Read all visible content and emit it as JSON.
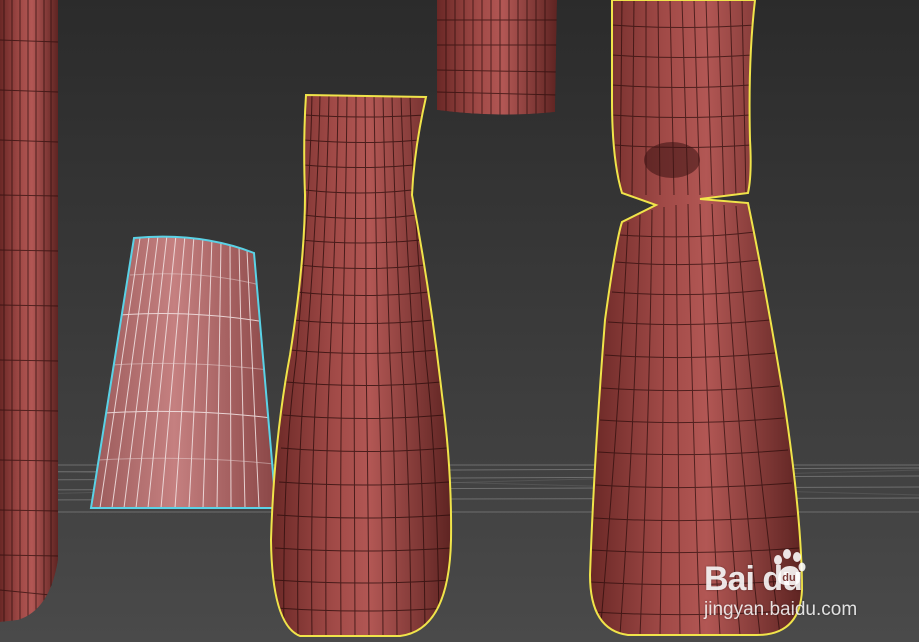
{
  "viewport": {
    "background_top": "#2a2a2a",
    "background_bottom": "#4c4c4c",
    "grid_color": "#8a8a8a"
  },
  "objects": [
    {
      "name": "tall-cylinder-left",
      "selected": false
    },
    {
      "name": "tapered-cup",
      "selected": true,
      "selection_color": "#5ad2e6"
    },
    {
      "name": "vase",
      "selected": true,
      "selection_color": "#f0e44a"
    },
    {
      "name": "hanging-block",
      "selected": false
    },
    {
      "name": "pinched-bottle",
      "selected": true,
      "selection_color": "#f0e44a"
    }
  ],
  "material_color": "#8a3c3a",
  "watermark": {
    "brand_text": "Bai du",
    "domain_text": "jingyan.baidu.com",
    "icon": "paw-icon"
  }
}
